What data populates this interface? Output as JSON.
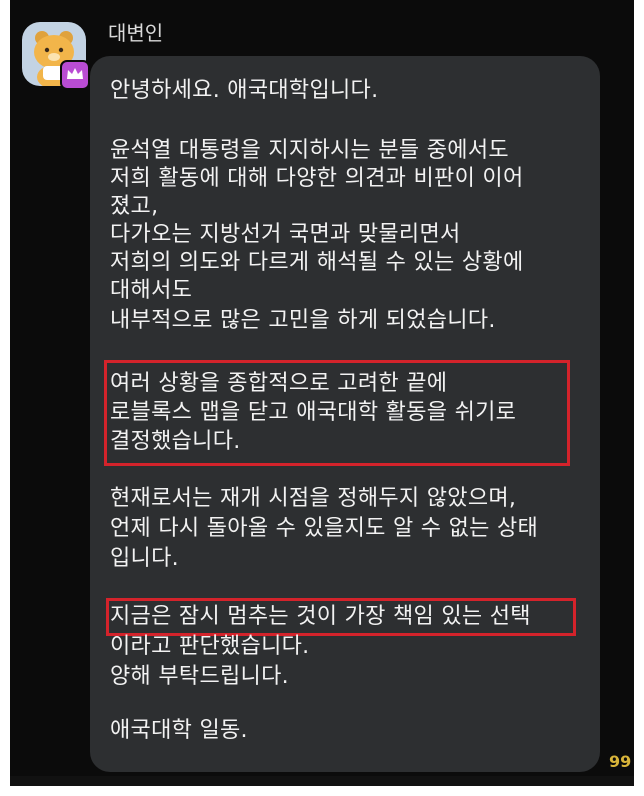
{
  "chat": {
    "sender_name": "대변인",
    "read_count": "99",
    "message": {
      "lines": [
        "안녕하세요. 애국대학입니다.",
        "윤석열 대통령을 지지하시는 분들 중에서도",
        "저희 활동에 대해 다양한 의견과 비판이 이어",
        "졌고,",
        "다가오는 지방선거 국면과 맞물리면서",
        "저희의 의도와 다르게 해석될 수 있는 상황에",
        "대해서도",
        "내부적으로 많은 고민을 하게 되었습니다.",
        "여러 상황을 종합적으로 고려한 끝에",
        "로블록스 맵을 닫고 애국대학 활동을 쉬기로",
        "결정했습니다.",
        "현재로서는 재개 시점을 정해두지 않았으며,",
        "언제 다시 돌아올 수 있을지도 알 수 없는 상태",
        "입니다.",
        "지금은 잠시 멈추는 것이 가장 책임 있는 선택",
        "이라고 판단했습니다.",
        "양해 부탁드립니다.",
        "애국대학 일동."
      ]
    }
  },
  "colors": {
    "background": "#0b0b0b",
    "bubble": "#2d2f31",
    "text": "#f2f2f2",
    "highlight_border": "#d4232b",
    "read_count": "#d8b43a",
    "avatar_badge": "#b94cd3"
  },
  "icons": {
    "avatar": "bear-mascot-avatar",
    "badge": "crown-icon"
  }
}
